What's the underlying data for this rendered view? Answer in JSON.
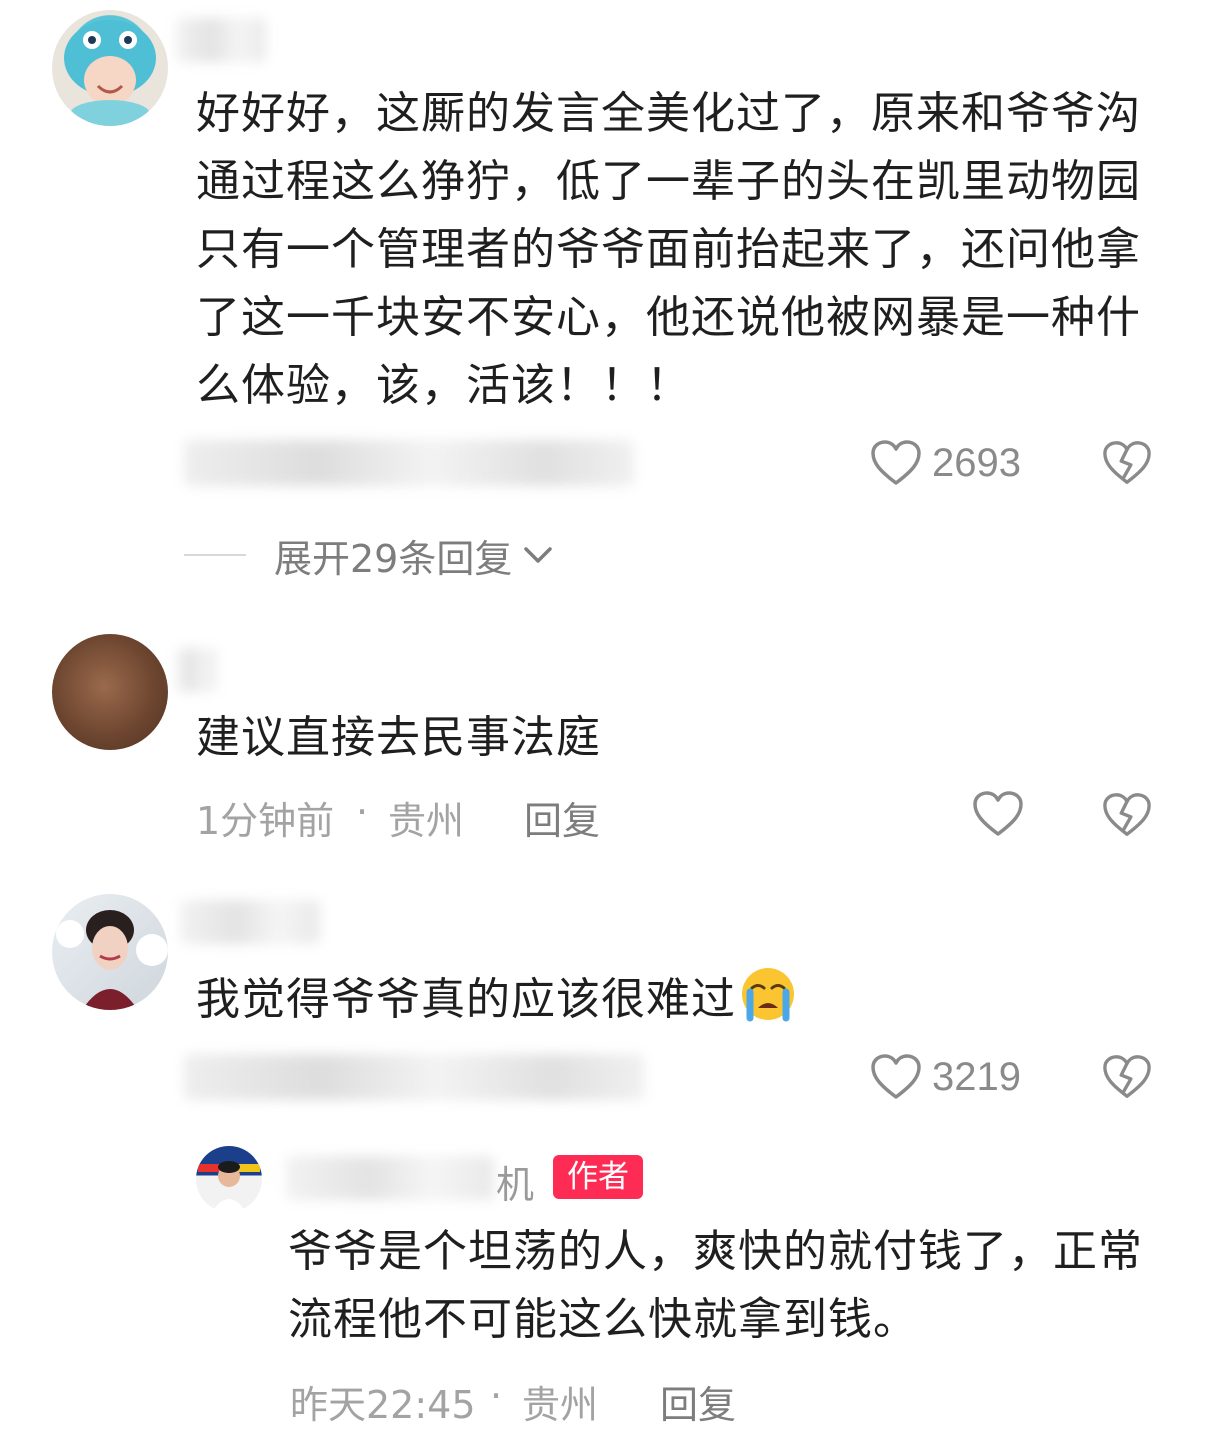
{
  "comments": [
    {
      "text": "好好好，这厮的发言全美化过了，原来和爷爷沟通过程这么狰狞，低了一辈子的头在凯里动物园只有一个管理者的爷爷面前抬起来了，还问他拿了这一千块安不安心，他还说他被网暴是一种什么体验，该，活该！！！",
      "likes": "2693",
      "expand_label": "展开29条回复"
    },
    {
      "text": "建议直接去民事法庭",
      "time": "1分钟前",
      "separator": "·",
      "location": "贵州",
      "reply": "回复"
    },
    {
      "text": "我觉得爷爷真的应该很难过",
      "emoji": "loudly-crying-face-emoji",
      "likes": "3219"
    }
  ],
  "reply": {
    "name_visible_tail": "机",
    "badge": "作者",
    "text": "爷爷是个坦荡的人，爽快的就付钱了，正常流程他不可能这么快就拿到钱。",
    "time": "昨天22:45",
    "separator": "·",
    "location": "贵州",
    "reply": "回复"
  },
  "icons": {
    "like": "heart-outline-icon",
    "dislike": "broken-heart-icon",
    "expand": "chevron-down-icon"
  },
  "colors": {
    "badge": "#fe2c55",
    "meta_text": "#a3a3a3",
    "body_text": "#1f1f1f"
  }
}
